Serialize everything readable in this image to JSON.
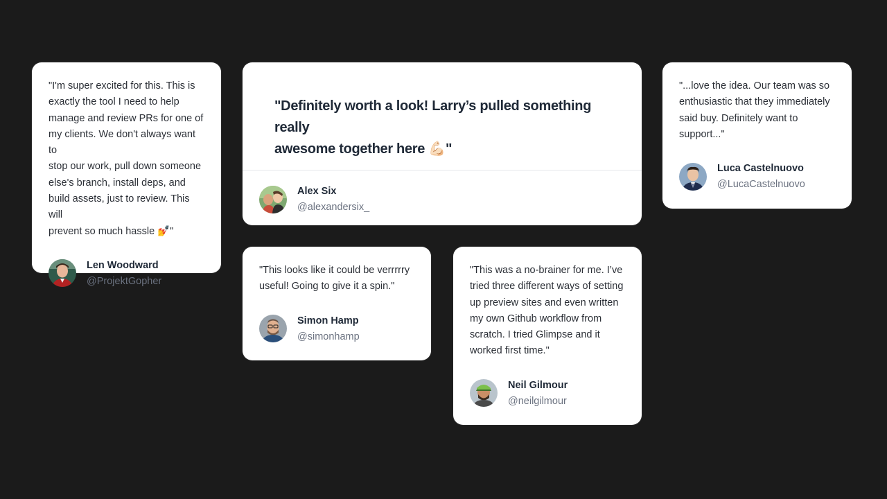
{
  "colors": {
    "background": "#1b1b1b",
    "card": "#ffffff",
    "text": "#2b2f36",
    "handle": "#6b7280",
    "divider": "#e6e8eb"
  },
  "testimonials": {
    "len": {
      "quote": "\"I'm super excited for this. This is\nexactly the tool I need to help\nmanage and review PRs for one of\nmy clients. We don't always want to\nstop our work, pull down someone\nelse's branch, install deps, and\nbuild assets, just to review. This will\nprevent so much hassle 💅\"",
      "name": "Len Woodward",
      "handle": "@ProjektGopher",
      "avatar_icon": "avatar-len-woodward"
    },
    "alex": {
      "quote": "\"Definitely worth a look! Larry’s pulled something really\nawesome together here 💪🏻\"",
      "name": "Alex Six",
      "handle": "@alexandersix_",
      "avatar_icon": "avatar-alex-six"
    },
    "luca": {
      "quote": "\"...love the idea. Our team was so\nenthusiastic that they immediately\nsaid buy. Definitely want to\nsupport...\"",
      "name": "Luca Castelnuovo",
      "handle": "@LucaCastelnuovo",
      "avatar_icon": "avatar-luca-castelnuovo"
    },
    "simon": {
      "quote": "\"This looks like it could be verrrrry\nuseful! Going to give it a spin.\"",
      "name": "Simon Hamp",
      "handle": "@simonhamp",
      "avatar_icon": "avatar-simon-hamp"
    },
    "neil": {
      "quote": "\"This was a no-brainer for me. I’ve\ntried three different ways of setting\nup preview sites and even written\nmy own Github workflow from\nscratch. I tried Glimpse and it\nworked first time.\"",
      "name": "Neil Gilmour",
      "handle": "@neilgilmour",
      "avatar_icon": "avatar-neil-gilmour"
    }
  }
}
